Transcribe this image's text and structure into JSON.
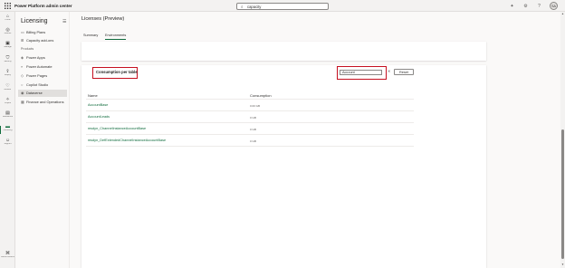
{
  "header": {
    "app_title": "Power Platform admin center",
    "search_value": "capacity",
    "avatar_initials": "SA"
  },
  "rail": {
    "items": [
      {
        "label": "Home",
        "icon": "home-icon"
      },
      {
        "label": "Actions",
        "icon": "actions-icon"
      },
      {
        "label": "Manage",
        "icon": "manage-icon"
      },
      {
        "label": "Security",
        "icon": "security-icon"
      },
      {
        "label": "Deploy",
        "icon": "deploy-icon"
      },
      {
        "label": "Monitor",
        "icon": "monitor-icon"
      },
      {
        "label": "Copilot",
        "icon": "copilot-icon"
      },
      {
        "label": "Resources",
        "icon": "resources-icon"
      },
      {
        "label": "Licensing",
        "icon": "licensing-icon"
      },
      {
        "label": "Support",
        "icon": "support-icon"
      }
    ],
    "bottom_item": {
      "label": "Admin centers",
      "icon": "admin-centers-icon"
    }
  },
  "nav": {
    "title": "Licensing",
    "top_items": [
      {
        "label": "Billing Plans"
      },
      {
        "label": "Capacity add-ons"
      }
    ],
    "section_label": "Products",
    "product_items": [
      {
        "label": "Power Apps"
      },
      {
        "label": "Power Automate"
      },
      {
        "label": "Power Pages"
      },
      {
        "label": "Copilot Studio"
      },
      {
        "label": "Dataverse"
      },
      {
        "label": "Finance and Operations"
      }
    ],
    "active_item": "Dataverse"
  },
  "main": {
    "page_title": "Licenses (Preview)",
    "tabs": [
      {
        "label": "Summary"
      },
      {
        "label": "Environments"
      }
    ],
    "active_tab": "Environments",
    "table_section": {
      "title": "Consumption per table",
      "filter_value": "Account",
      "reset_label": "Reset",
      "columns": [
        "Name",
        "Consumption"
      ],
      "rows": [
        {
          "name": "AccountBase",
          "consumption": "0.00 GB"
        },
        {
          "name": "AccountLeads",
          "consumption": "0 GB"
        },
        {
          "name": "msdyn_ChannelInstanceAccountBase",
          "consumption": "0 GB"
        },
        {
          "name": "msdyn_DefExtendedChannelInstanceAccountBase",
          "consumption": "0 GB"
        }
      ]
    }
  },
  "colors": {
    "accent": "#0f6b3c",
    "highlight_border": "#c50f1f"
  }
}
